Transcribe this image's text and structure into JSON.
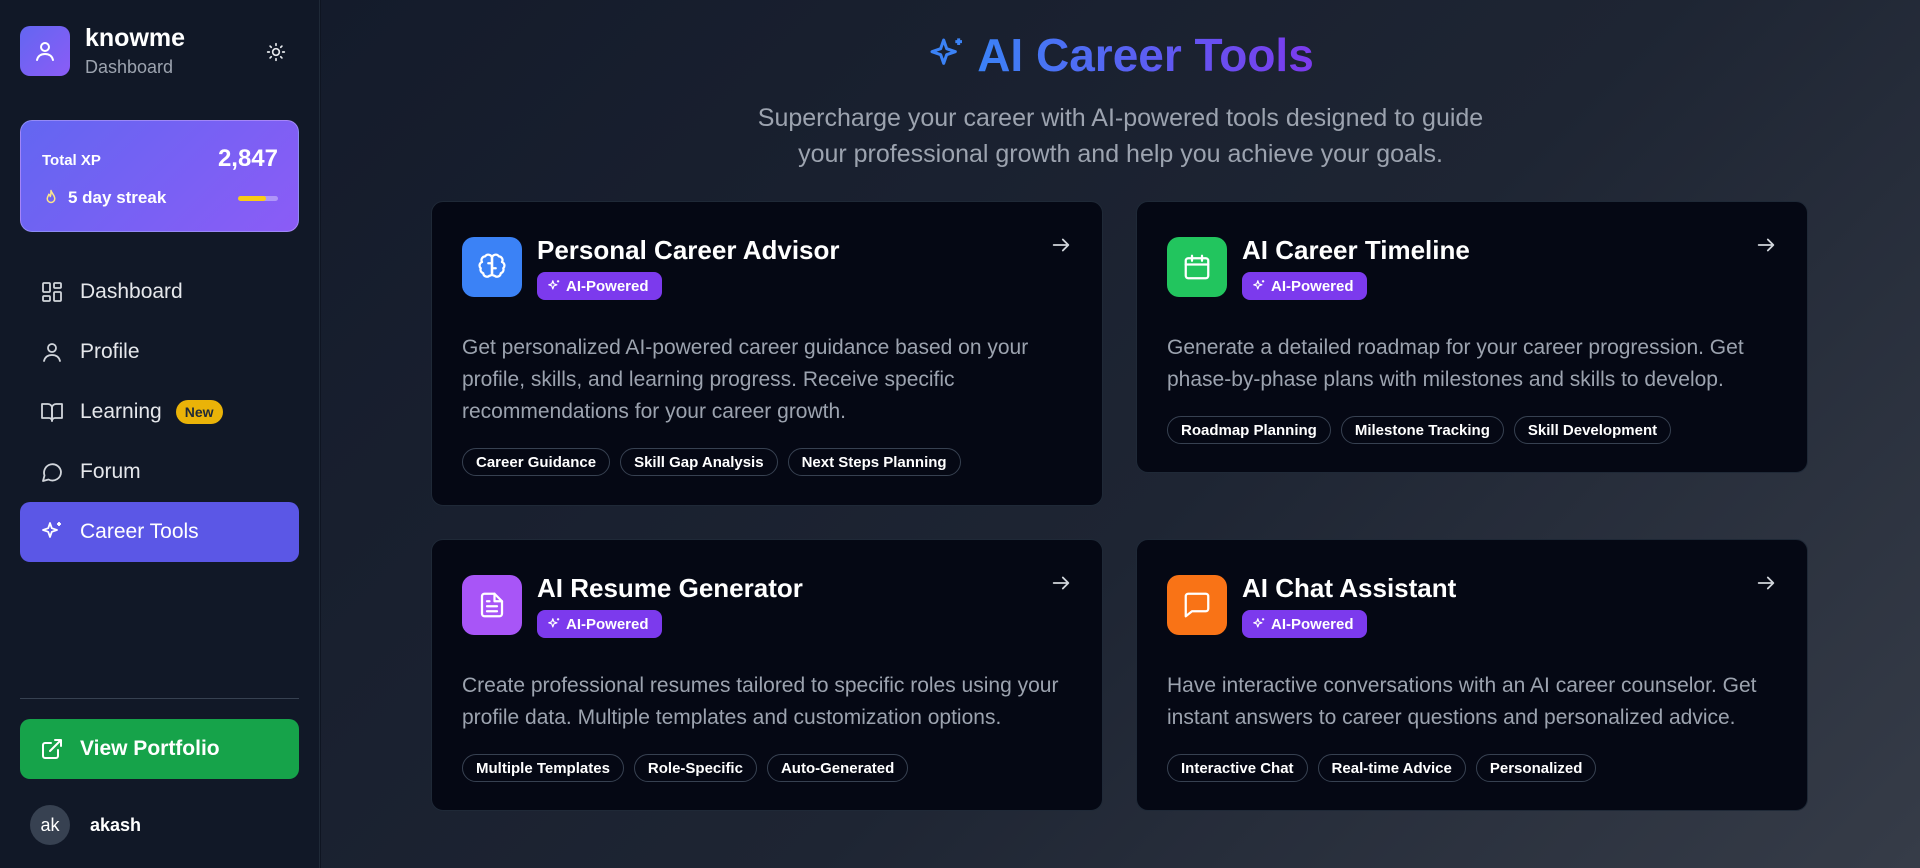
{
  "app": {
    "name": "knowme",
    "section": "Dashboard"
  },
  "xp": {
    "label": "Total XP",
    "value": "2,847",
    "streak": "5 day streak",
    "streak_progress": 0.7
  },
  "nav": {
    "items": [
      {
        "label": "Dashboard",
        "icon": "grid-icon",
        "active": false
      },
      {
        "label": "Profile",
        "icon": "user-icon",
        "active": false
      },
      {
        "label": "Learning",
        "icon": "book-icon",
        "active": false,
        "badge": "New"
      },
      {
        "label": "Forum",
        "icon": "chat-icon",
        "active": false
      },
      {
        "label": "Career Tools",
        "icon": "sparkles-icon",
        "active": true
      }
    ]
  },
  "portfolio": {
    "label": "View Portfolio"
  },
  "user": {
    "initials": "ak",
    "name": "akash"
  },
  "page": {
    "title": "AI Career Tools",
    "subtitle_line1": "Supercharge your career with AI-powered tools designed to guide",
    "subtitle_line2": "your professional growth and help you achieve your goals."
  },
  "cards": [
    {
      "title": "Personal Career Advisor",
      "badge": "AI-Powered",
      "description": "Get personalized AI-powered career guidance based on your profile, skills, and learning progress. Receive specific recommendations for your career growth.",
      "tags": [
        "Career Guidance",
        "Skill Gap Analysis",
        "Next Steps Planning"
      ],
      "icon": "brain-icon",
      "color": "#3b82f6"
    },
    {
      "title": "AI Career Timeline",
      "badge": "AI-Powered",
      "description": "Generate a detailed roadmap for your career progression. Get phase-by-phase plans with milestones and skills to develop.",
      "tags": [
        "Roadmap Planning",
        "Milestone Tracking",
        "Skill Development"
      ],
      "icon": "calendar-icon",
      "color": "#22c55e"
    },
    {
      "title": "AI Resume Generator",
      "badge": "AI-Powered",
      "description": "Create professional resumes tailored to specific roles using your profile data. Multiple templates and customization options.",
      "tags": [
        "Multiple Templates",
        "Role-Specific",
        "Auto-Generated"
      ],
      "icon": "document-icon",
      "color": "#a855f7"
    },
    {
      "title": "AI Chat Assistant",
      "badge": "AI-Powered",
      "description": "Have interactive conversations with an AI career counselor. Get instant answers to career questions and personalized advice.",
      "tags": [
        "Interactive Chat",
        "Real-time Advice",
        "Personalized"
      ],
      "icon": "message-icon",
      "color": "#f97316"
    }
  ]
}
